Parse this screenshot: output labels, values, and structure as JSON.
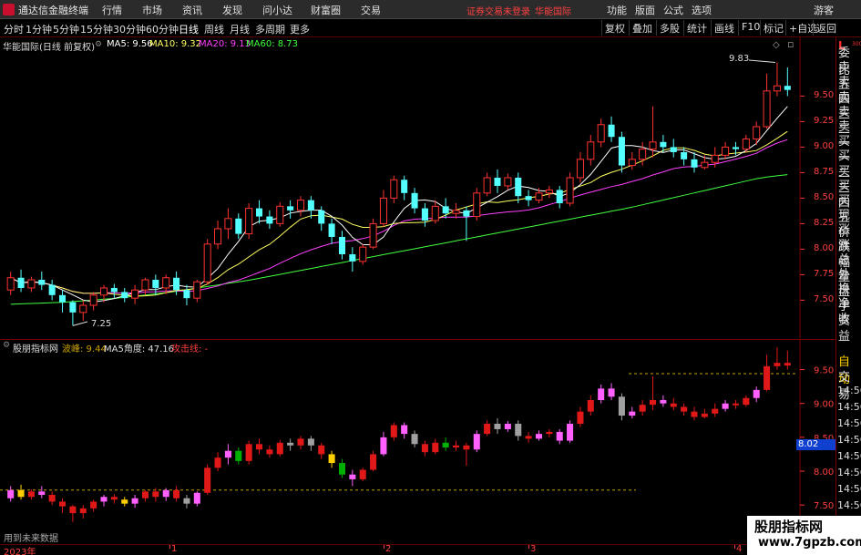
{
  "titlebar": {
    "app_name": "通达信金融终端",
    "menus": [
      "行情",
      "市场",
      "资讯",
      "发现",
      "问小达",
      "财富圈",
      "交易"
    ],
    "status_red": "证券交易未登录",
    "stock_red": "华能国际",
    "right_menus": [
      "功能",
      "版面",
      "公式",
      "选项"
    ],
    "guest": "游客"
  },
  "tabbar": {
    "tabs": [
      "分时",
      "1分钟",
      "5分钟",
      "15分钟",
      "30分钟",
      "60分钟",
      "日线",
      "周线",
      "月线",
      "多周期",
      "更多"
    ],
    "active_tab": "日线",
    "right_tabs": [
      "复权",
      "叠加",
      "多股",
      "统计",
      "画线",
      "F10",
      "标记",
      "+自选",
      "返回"
    ]
  },
  "main_chart": {
    "title": "华能国际(日线 前复权)",
    "ma_labels": [
      {
        "text": "MA5: 9.56",
        "color": "#ffffff"
      },
      {
        "text": "MA10: 9.32",
        "color": "#ffff60"
      },
      {
        "text": "MA20: 9.13",
        "color": "#ff40ff"
      },
      {
        "text": "MA60: 8.73",
        "color": "#40ff40"
      }
    ],
    "y_ticks": [
      "9.50",
      "9.25",
      "9.00",
      "8.75",
      "8.50",
      "8.25",
      "8.00",
      "7.75",
      "7.50"
    ],
    "high_label": "9.83",
    "low_label": "7.25"
  },
  "sub_chart": {
    "title": "股朋指标网",
    "wave_label": "波峰: 9.44",
    "angle_label": "MA5角度: 47.16",
    "attack_label": "攻击线: -",
    "y_ticks": [
      "9.50",
      "9.00",
      "8.50",
      "8.00",
      "7.50",
      "7.00"
    ],
    "price_marker": "8.02"
  },
  "side_panel": {
    "L": "L",
    "L_sub": "300",
    "items": [
      "委比",
      "卖五",
      "卖四",
      "卖三",
      "卖二",
      "卖一",
      "买一",
      "买二",
      "买三",
      "买四",
      "买五",
      "现价",
      "涨跌",
      "涨幅",
      "总量",
      "外盘",
      "换手",
      "净资",
      "收益"
    ],
    "auto": "自动",
    "trade": "交易",
    "times": [
      "14:56",
      "14:56",
      "14:56",
      "14:56",
      "14:56",
      "14:56",
      "14:56",
      "14:56"
    ]
  },
  "timebar": {
    "labels": [
      "2023年",
      "1",
      "2",
      "3",
      "4"
    ]
  },
  "future_label": "用到未来数据",
  "watermark": {
    "name": "股朋指标网",
    "url": "www.7gpzb.com"
  },
  "colors": {
    "up": "#ff3232",
    "down": "#54ffff",
    "ma5": "#ffffff",
    "ma10": "#ffff60",
    "ma20": "#ff40ff",
    "ma60": "#40ff40",
    "sub_pink": "#ff60ff",
    "sub_red": "#e01818",
    "sub_green": "#00b000",
    "sub_gray": "#a0a0a0",
    "sub_yellow": "#ffd000",
    "dash": "#c8a000"
  },
  "chart_data": {
    "type": "candlestick",
    "ylim": [
      7.2,
      9.95
    ],
    "candles": [
      [
        7.6,
        7.72,
        7.55,
        7.78
      ],
      [
        7.72,
        7.62,
        7.58,
        7.8
      ],
      [
        7.62,
        7.7,
        7.58,
        7.73
      ],
      [
        7.7,
        7.65,
        7.6,
        7.78
      ],
      [
        7.65,
        7.55,
        7.5,
        7.7
      ],
      [
        7.55,
        7.48,
        7.38,
        7.6
      ],
      [
        7.48,
        7.38,
        7.25,
        7.5
      ],
      [
        7.38,
        7.45,
        7.3,
        7.5
      ],
      [
        7.45,
        7.55,
        7.4,
        7.58
      ],
      [
        7.55,
        7.62,
        7.48,
        7.65
      ],
      [
        7.62,
        7.58,
        7.52,
        7.66
      ],
      [
        7.58,
        7.52,
        7.48,
        7.62
      ],
      [
        7.52,
        7.6,
        7.46,
        7.65
      ],
      [
        7.6,
        7.7,
        7.55,
        7.72
      ],
      [
        7.7,
        7.62,
        7.55,
        7.75
      ],
      [
        7.62,
        7.72,
        7.56,
        7.75
      ],
      [
        7.72,
        7.6,
        7.55,
        7.78
      ],
      [
        7.6,
        7.52,
        7.45,
        7.65
      ],
      [
        7.52,
        7.68,
        7.48,
        7.7
      ],
      [
        7.68,
        8.05,
        7.65,
        8.1
      ],
      [
        8.05,
        8.2,
        8.0,
        8.28
      ],
      [
        8.2,
        8.3,
        8.1,
        8.4
      ],
      [
        8.3,
        8.15,
        8.1,
        8.35
      ],
      [
        8.15,
        8.4,
        8.1,
        8.45
      ],
      [
        8.4,
        8.32,
        8.25,
        8.48
      ],
      [
        8.32,
        8.25,
        8.2,
        8.38
      ],
      [
        8.25,
        8.42,
        8.22,
        8.46
      ],
      [
        8.42,
        8.38,
        8.3,
        8.48
      ],
      [
        8.38,
        8.48,
        8.32,
        8.52
      ],
      [
        8.48,
        8.38,
        8.3,
        8.52
      ],
      [
        8.38,
        8.25,
        8.18,
        8.42
      ],
      [
        8.25,
        8.12,
        8.05,
        8.3
      ],
      [
        8.12,
        7.95,
        7.9,
        8.18
      ],
      [
        7.95,
        7.88,
        7.78,
        8.02
      ],
      [
        7.88,
        8.02,
        7.85,
        8.05
      ],
      [
        8.02,
        8.25,
        8.0,
        8.3
      ],
      [
        8.25,
        8.5,
        8.22,
        8.58
      ],
      [
        8.5,
        8.68,
        8.45,
        8.72
      ],
      [
        8.68,
        8.55,
        8.48,
        8.72
      ],
      [
        8.55,
        8.4,
        8.35,
        8.6
      ],
      [
        8.4,
        8.28,
        8.22,
        8.45
      ],
      [
        8.28,
        8.42,
        8.25,
        8.48
      ],
      [
        8.42,
        8.35,
        8.3,
        8.5
      ],
      [
        8.35,
        8.38,
        8.3,
        8.45
      ],
      [
        8.38,
        8.32,
        8.08,
        8.42
      ],
      [
        8.32,
        8.55,
        8.28,
        8.6
      ],
      [
        8.55,
        8.7,
        8.52,
        8.75
      ],
      [
        8.7,
        8.62,
        8.55,
        8.78
      ],
      [
        8.62,
        8.7,
        8.58,
        8.74
      ],
      [
        8.7,
        8.52,
        8.45,
        8.75
      ],
      [
        8.52,
        8.48,
        8.42,
        8.58
      ],
      [
        8.48,
        8.55,
        8.45,
        8.6
      ],
      [
        8.55,
        8.58,
        8.5,
        8.62
      ],
      [
        8.58,
        8.45,
        8.4,
        8.62
      ],
      [
        8.45,
        8.7,
        8.42,
        8.75
      ],
      [
        8.7,
        8.88,
        8.65,
        8.95
      ],
      [
        8.88,
        9.05,
        8.82,
        9.12
      ],
      [
        9.05,
        9.22,
        9.0,
        9.28
      ],
      [
        9.22,
        9.1,
        9.05,
        9.3
      ],
      [
        9.1,
        8.82,
        8.75,
        9.15
      ],
      [
        8.82,
        8.88,
        8.78,
        8.95
      ],
      [
        8.88,
        8.98,
        8.82,
        9.05
      ],
      [
        8.98,
        9.05,
        8.9,
        9.4
      ],
      [
        9.05,
        9.0,
        8.95,
        9.12
      ],
      [
        9.0,
        8.95,
        8.9,
        9.08
      ],
      [
        8.95,
        8.88,
        8.82,
        9.0
      ],
      [
        8.88,
        8.8,
        8.75,
        8.95
      ],
      [
        8.8,
        8.85,
        8.78,
        8.92
      ],
      [
        8.85,
        8.92,
        8.8,
        9.0
      ],
      [
        8.92,
        9.0,
        8.88,
        9.05
      ],
      [
        9.0,
        8.98,
        8.92,
        9.05
      ],
      [
        8.98,
        9.08,
        8.95,
        9.12
      ],
      [
        9.08,
        9.2,
        9.02,
        9.25
      ],
      [
        9.2,
        9.55,
        9.18,
        9.72
      ],
      [
        9.55,
        9.6,
        9.5,
        9.83
      ],
      [
        9.6,
        9.56,
        9.5,
        9.78
      ]
    ],
    "ma60": [
      7.46,
      7.47,
      7.48,
      7.5,
      7.52,
      7.55,
      7.58,
      7.62,
      7.66,
      7.7,
      7.75,
      7.8,
      7.85,
      7.9,
      7.95,
      8.0,
      8.05,
      8.1,
      8.15,
      8.2,
      8.25,
      8.3,
      8.35,
      8.4,
      8.46,
      8.52,
      8.58,
      8.64,
      8.7,
      8.73
    ]
  }
}
